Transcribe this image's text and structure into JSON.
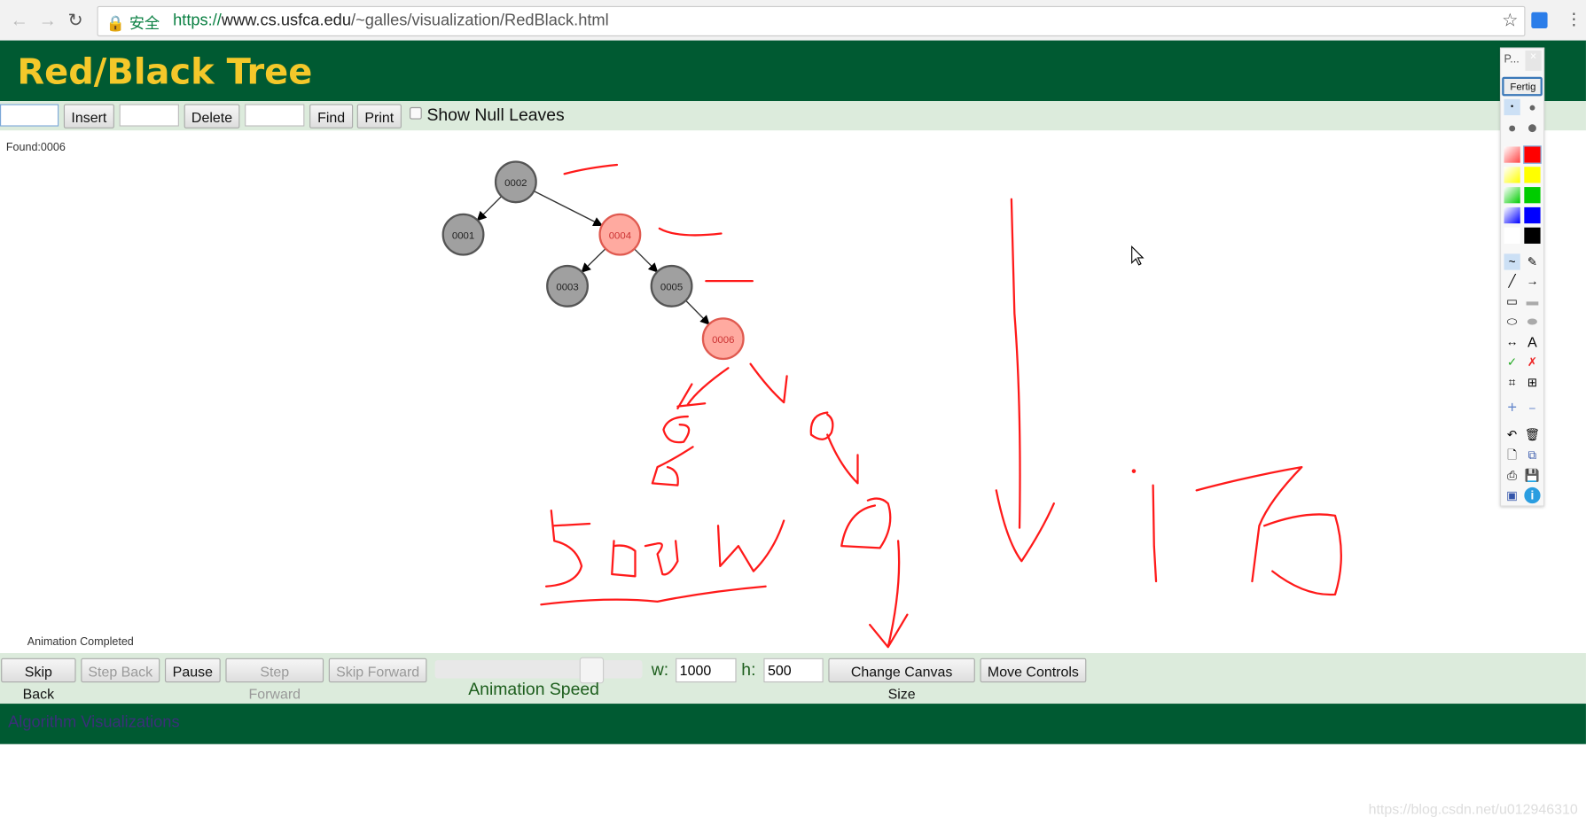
{
  "browser": {
    "secure_label": "安全",
    "url_scheme": "https://",
    "url_domain": "www.cs.usfca.edu",
    "url_path": "/~galles/visualization/RedBlack.html"
  },
  "header": {
    "title": "Red/Black Tree"
  },
  "toolbar": {
    "insert_value": "",
    "insert_label": "Insert",
    "delete_value": "",
    "delete_label": "Delete",
    "find_value": "",
    "find_label": "Find",
    "print_label": "Print",
    "show_null_leaves_label": "Show Null Leaves",
    "show_null_leaves_checked": false
  },
  "canvas": {
    "status_top": "Found:0006",
    "status_bottom": "Animation Completed",
    "nodes": [
      {
        "key": "0002",
        "color": "black"
      },
      {
        "key": "0001",
        "color": "black"
      },
      {
        "key": "0004",
        "color": "red"
      },
      {
        "key": "0003",
        "color": "black"
      },
      {
        "key": "0005",
        "color": "black"
      },
      {
        "key": "0006",
        "color": "red"
      }
    ],
    "edges": [
      [
        "0002",
        "0001"
      ],
      [
        "0002",
        "0004"
      ],
      [
        "0004",
        "0003"
      ],
      [
        "0004",
        "0005"
      ],
      [
        "0005",
        "0006"
      ]
    ],
    "node_colors": {
      "black": "#a0a0a0",
      "red": "#ffaaa0"
    },
    "annotation_color": "#ff0000"
  },
  "controls": {
    "skip_back": "Skip Back",
    "step_back": "Step Back",
    "pause": "Pause",
    "step_forward": "Step Forward",
    "skip_forward": "Skip Forward",
    "speed_label": "Animation Speed",
    "speed_value": 0.75,
    "w_label": "w:",
    "w_value": "1000",
    "h_label": "h:",
    "h_value": "500",
    "change_canvas": "Change Canvas Size",
    "move_controls": "Move Controls"
  },
  "footer": {
    "link": "Algorithm Visualizations"
  },
  "palette": {
    "title": "P...",
    "done": "Fertig",
    "text_tool": "A"
  },
  "watermark": "https://blog.csdn.net/u012946310",
  "colors": {
    "header": "#005a32",
    "title": "#f4c82a",
    "toolbar": "#dcebdc"
  }
}
